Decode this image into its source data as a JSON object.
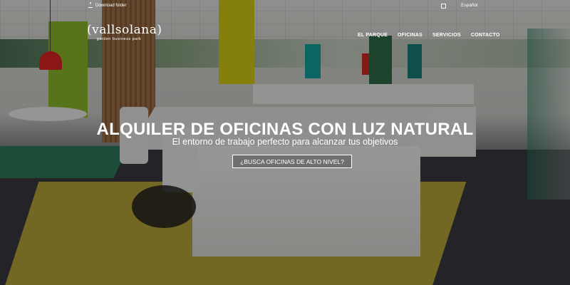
{
  "topbar": {
    "download_label": "Download folder",
    "language_label": "Español"
  },
  "logo": {
    "name": "vallsolana",
    "tagline": "garden business park"
  },
  "nav": {
    "items": [
      {
        "label": "EL PARQUE"
      },
      {
        "label": "OFICINAS"
      },
      {
        "label": "SERVICIOS"
      },
      {
        "label": "CONTACTO"
      }
    ]
  },
  "hero": {
    "headline": "ALQUILER DE OFICINAS CON LUZ NATURAL",
    "subheadline": "El entorno de trabajo perfecto para alcanzar tus objetivos",
    "cta_label": "¿BUSCA OFICINAS DE ALTO NIVEL?"
  },
  "icons": {
    "download": "download-icon",
    "language": "language-icon"
  },
  "colors": {
    "accent_lime": "#8ebc2a",
    "accent_yellow": "#d7cf16",
    "accent_teal": "#14a3a1",
    "lamp_red": "#e02424"
  }
}
